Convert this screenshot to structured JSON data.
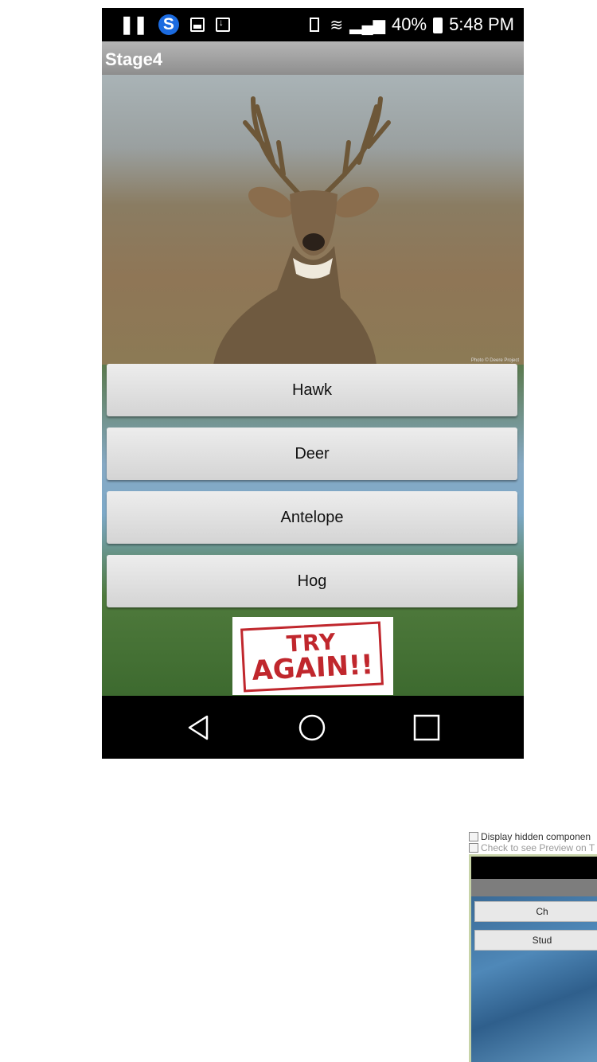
{
  "status_bar": {
    "battery_percent": "40%",
    "time": "5:48 PM",
    "icons": [
      "pause-icon",
      "s-app-icon",
      "gallery-icon",
      "download-icon",
      "vibrate-icon",
      "wifi-icon",
      "signal-icon",
      "battery-icon"
    ]
  },
  "app": {
    "title": "Stage4",
    "photo_credit": "Photo © Deere Project",
    "answers": [
      "Hawk",
      "Deer",
      "Antelope",
      "Hog"
    ],
    "try_again": {
      "line1": "TRY",
      "line2": "AGAIN!!"
    }
  },
  "nav_bar": {
    "icons": [
      "back-icon",
      "home-icon",
      "recent-apps-icon"
    ]
  },
  "designer": {
    "display_hidden": "Display hidden componen",
    "preview_check": "Check to see Preview on T",
    "buttons": [
      "Ch",
      "Stud"
    ]
  },
  "colors": {
    "stamp_red": "#c0272d",
    "title_bar": "#9e9e9e",
    "status_s_icon": "#1b6be0"
  }
}
